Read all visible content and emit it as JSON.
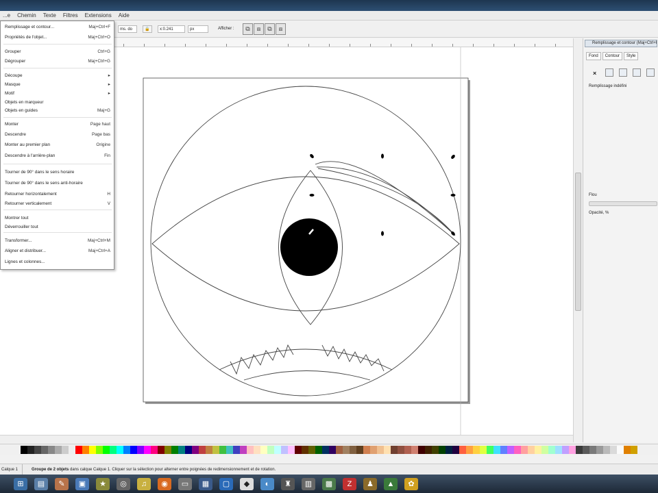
{
  "menubar": {
    "items": [
      "...e",
      "Chemin",
      "Texte",
      "Filtres",
      "Extensions",
      "Aide"
    ]
  },
  "toolbar": {
    "field1": "ms. do",
    "field2": "x:0.241",
    "unit": "px",
    "affichage_label": "Afficher :"
  },
  "dropdown": {
    "items": [
      {
        "label": "Remplissage et contour...",
        "shortcut": "Maj+Ctrl+F"
      },
      {
        "label": "Propriétés de l'objet...",
        "shortcut": "Maj+Ctrl+O"
      },
      {
        "label": "Grouper",
        "shortcut": "Ctrl+G"
      },
      {
        "label": "Dégrouper",
        "shortcut": "Maj+Ctrl+G"
      },
      {
        "label": "Découpe",
        "shortcut": "▸"
      },
      {
        "label": "Masque",
        "shortcut": "▸"
      },
      {
        "label": "Motif",
        "shortcut": "▸"
      },
      {
        "label": "Objets en marqueur",
        "shortcut": ""
      },
      {
        "label": "Objets en guides",
        "shortcut": "Maj+G"
      },
      {
        "label": "Monter",
        "shortcut": "Page haut"
      },
      {
        "label": "Descendre",
        "shortcut": "Page bas"
      },
      {
        "label": "Monter au premier plan",
        "shortcut": "Origine"
      },
      {
        "label": "Descendre à l'arrière-plan",
        "shortcut": "Fin"
      },
      {
        "label": "Tourner de 90° dans le sens horaire",
        "shortcut": ""
      },
      {
        "label": "Tourner de 90° dans le sens anti-horaire",
        "shortcut": ""
      },
      {
        "label": "Retourner horizontalement",
        "shortcut": "H"
      },
      {
        "label": "Retourner verticalement",
        "shortcut": "V"
      },
      {
        "label": "Montrer tout",
        "shortcut": ""
      },
      {
        "label": "Déverrouiller tout",
        "shortcut": ""
      },
      {
        "label": "Transformer...",
        "shortcut": "Maj+Ctrl+M"
      },
      {
        "label": "Aligner et distribuer...",
        "shortcut": "Maj+Ctrl+A"
      },
      {
        "label": "Lignes et colonnes...",
        "shortcut": ""
      }
    ]
  },
  "rightpanel": {
    "title": "Remplissage et contour (Maj+Ctrl+F)",
    "tabs": [
      "Fond",
      "Contour",
      "Style"
    ],
    "fill_status": "Remplissage indéfini",
    "blur_label": "Flou",
    "opacity_label": "Opacité, %"
  },
  "statusbar": {
    "layer": "Calque 1",
    "message_bold": "Groupe de 2 objets",
    "message": " dans calque Calque 1. Cliquer sur la sélection pour alterner entre poignées de redimensionnement et de rotation."
  },
  "palette": {
    "colors": [
      "#000000",
      "#222222",
      "#444444",
      "#666666",
      "#888888",
      "#aaaaaa",
      "#cccccc",
      "#eeeeee",
      "#ff0000",
      "#ff8000",
      "#ffff00",
      "#80ff00",
      "#00ff00",
      "#00ff80",
      "#00ffff",
      "#0080ff",
      "#0000ff",
      "#8000ff",
      "#ff00ff",
      "#ff0080",
      "#800000",
      "#808000",
      "#008000",
      "#008080",
      "#000080",
      "#800080",
      "#c04040",
      "#c08040",
      "#c0c040",
      "#40c040",
      "#40c0c0",
      "#4040c0",
      "#c040c0",
      "#ffc0c0",
      "#ffe0c0",
      "#ffffc0",
      "#c0ffc0",
      "#c0ffff",
      "#c0c0ff",
      "#ffc0ff",
      "#600000",
      "#603000",
      "#606000",
      "#006000",
      "#003060",
      "#300060",
      "#a06040",
      "#a08060",
      "#806040",
      "#604020",
      "#d08050",
      "#e0a070",
      "#f0c090",
      "#ffe0b0",
      "#704030",
      "#905040",
      "#b06050",
      "#d08070",
      "#400000",
      "#402000",
      "#404000",
      "#004000",
      "#002040",
      "#200040",
      "#ff6040",
      "#ffa040",
      "#ffd040",
      "#e0ff40",
      "#40ff60",
      "#40e0ff",
      "#6080ff",
      "#c060ff",
      "#ff60c0",
      "#ffa0a0",
      "#ffd0a0",
      "#fff0a0",
      "#d0ffa0",
      "#a0ffd0",
      "#a0e0ff",
      "#c0a0ff",
      "#ffa0e0",
      "#3a3a3a",
      "#5a5a5a",
      "#7a7a7a",
      "#9a9a9a",
      "#bababa",
      "#dadada",
      "#fafafa",
      "#e08000",
      "#d0a000"
    ]
  }
}
